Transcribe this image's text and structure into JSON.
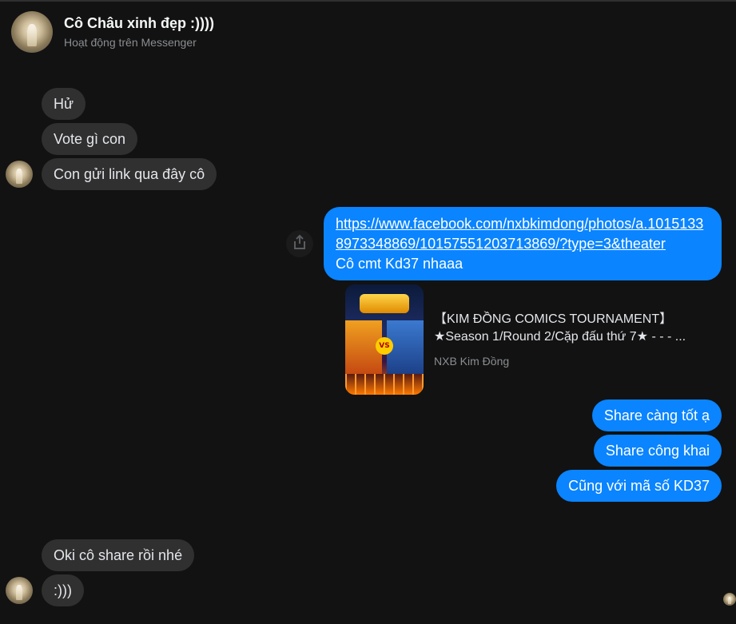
{
  "header": {
    "name": "Cô Châu xinh đẹp :))))",
    "status": "Hoạt động trên Messenger"
  },
  "messages_group1": [
    "Hử",
    "Vote gì con",
    "Con gửi link qua đây cô"
  ],
  "link_message": {
    "url": "https://www.facebook.com/nxbkimdong/photos/a.10151338973348869/10157551203713869/?type=3&theater",
    "text": "Cô cmt Kd37 nhaaa"
  },
  "preview": {
    "title_line1": "【KIM ĐỒNG COMICS TOURNAMENT】",
    "title_line2": "★Season 1/Round 2/Cặp đấu thứ 7★ - - - ...",
    "source": "NXB Kim Đồng",
    "thumb_vs": "VS"
  },
  "messages_out": [
    "Share càng tốt ạ",
    "Share công khai",
    "Cũng với mã số KD37"
  ],
  "messages_group2": [
    "Oki cô share rồi nhé",
    ":)))"
  ],
  "icons": {
    "share": "share-icon",
    "avatar": "avatar"
  },
  "colors": {
    "background": "#121212",
    "incoming_bubble": "#303030",
    "outgoing_bubble": "#0a84ff"
  }
}
